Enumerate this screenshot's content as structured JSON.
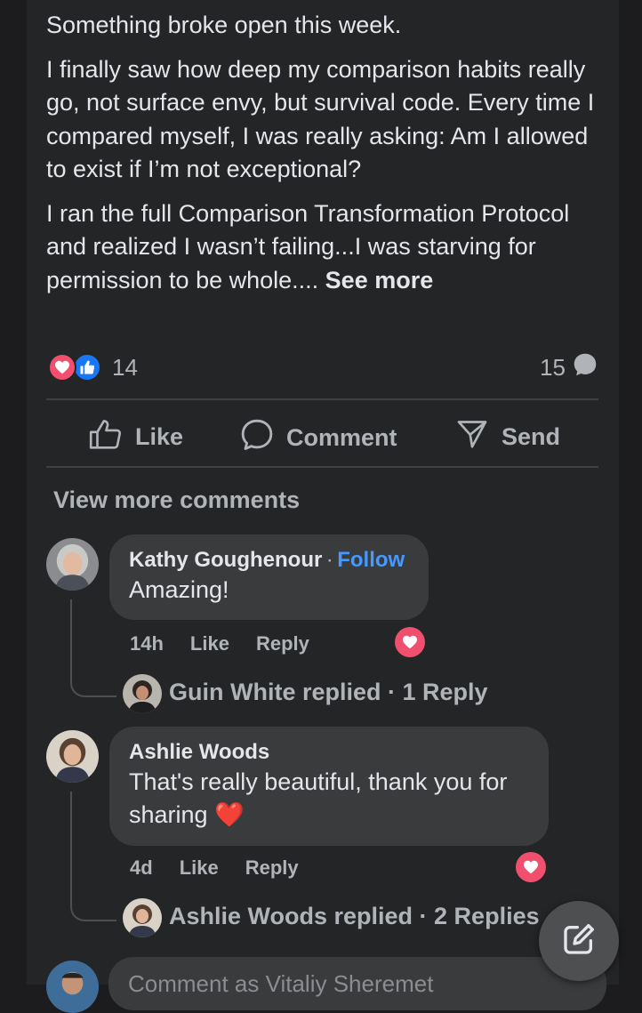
{
  "post": {
    "paragraphs": [
      "Something broke open this week.",
      "I finally saw how deep my comparison habits really go, not surface envy, but survival code. Every time I compared myself, I was really asking: Am I allowed to exist if I’m not exceptional?",
      "I ran the full Comparison Transformation Protocol and realized I wasn’t failing...I was starving for permission to be whole...."
    ],
    "see_more": "See more",
    "reaction_count": "14",
    "comment_count": "15"
  },
  "actions": {
    "like": "Like",
    "comment": "Comment",
    "send": "Send"
  },
  "view_more_comments": "View more comments",
  "comments": [
    {
      "name": "Kathy Goughenour",
      "separator": "·",
      "follow": "Follow",
      "text": "Amazing!",
      "time": "14h",
      "like": "Like",
      "reply": "Reply",
      "replied_summary": "Guin White replied · 1 Reply"
    },
    {
      "name": "Ashlie Woods",
      "text": "That's really beautiful, thank you for sharing ❤️",
      "time": "4d",
      "like": "Like",
      "reply": "Reply",
      "replied_summary": "Ashlie Woods replied · 2 Replies"
    }
  ],
  "composer": {
    "placeholder": "Comment as Vitaliy Sheremet"
  },
  "colors": {
    "background": "#242526",
    "love": "#f0506e",
    "like": "#1877f2",
    "follow": "#4599ff"
  }
}
